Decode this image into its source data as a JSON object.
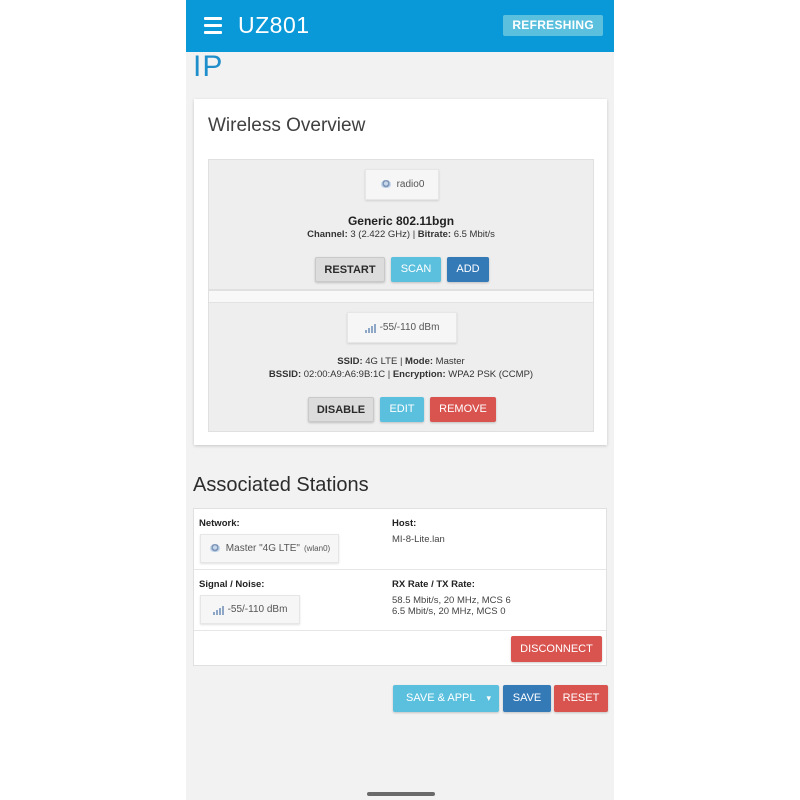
{
  "appbar": {
    "title": "UZ801",
    "refresh_label": "REFRESHING"
  },
  "page": {
    "partial_heading": "IP"
  },
  "wireless": {
    "title": "Wireless Overview",
    "device": {
      "badge_label": "radio0",
      "name": "Generic 802.11bgn",
      "channel_label": "Channel:",
      "channel_value": "3 (2.422 GHz)",
      "bitrate_label": "Bitrate:",
      "bitrate_value": "6.5 Mbit/s",
      "buttons": {
        "restart": "RESTART",
        "scan": "SCAN",
        "add": "ADD"
      }
    },
    "network": {
      "signal_badge": "-55/-110 dBm",
      "ssid_label": "SSID:",
      "ssid_value": "4G LTE",
      "mode_label": "Mode:",
      "mode_value": "Master",
      "bssid_label": "BSSID:",
      "bssid_value": "02:00:A9:A6:9B:1C",
      "encryption_label": "Encryption:",
      "encryption_value": "WPA2 PSK (CCMP)",
      "buttons": {
        "disable": "DISABLE",
        "edit": "EDIT",
        "remove": "REMOVE"
      }
    }
  },
  "stations": {
    "title": "Associated Stations",
    "network_label": "Network:",
    "network_badge_main": "Master \"4G LTE\"",
    "network_badge_sub": "(wlan0)",
    "host_label": "Host:",
    "host_value": "MI-8-Lite.lan",
    "signal_label": "Signal / Noise:",
    "signal_badge": "-55/-110 dBm",
    "rate_label": "RX Rate / TX Rate:",
    "rx_rate": "58.5 Mbit/s, 20 MHz, MCS 6",
    "tx_rate": "6.5 Mbit/s, 20 MHz, MCS 0",
    "disconnect": "DISCONNECT"
  },
  "footer": {
    "save_apply": "SAVE & APPL",
    "dropdown_caret": "▾",
    "save": "SAVE",
    "reset": "RESET"
  },
  "colors": {
    "appbar": "#0a99d8",
    "info": "#5bc0de",
    "primary": "#337ab7",
    "danger": "#d9534f",
    "heading_blue": "#1f8fcc"
  }
}
